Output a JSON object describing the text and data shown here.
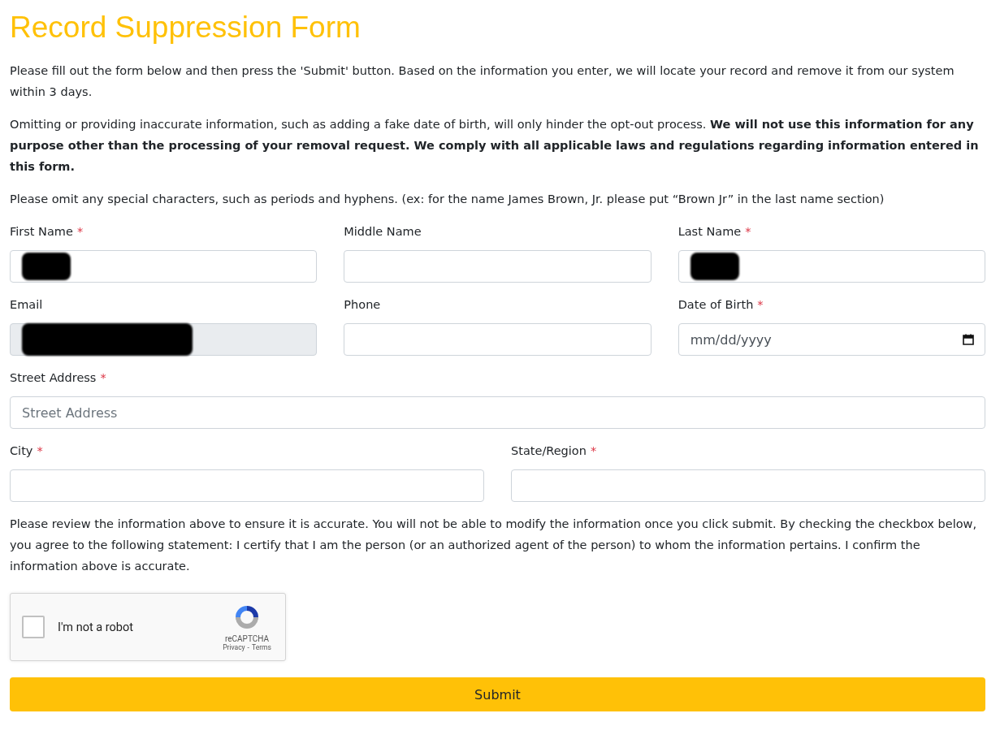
{
  "title": "Record Suppression Form",
  "intro": [
    "Please fill out the form below and then press the 'Submit' button. Based on the information you enter, we will locate your record and remove it from our system within 3 days.",
    "Omitting or providing inaccurate information, such as adding a fake date of birth, will only hinder the opt-out process. **We will not use this information for any purpose other than the processing of your removal request. We comply with all applicable laws and regulations regarding information entered in this form.**",
    "Please omit any special characters, such as periods and hyphens. (ex: for the name James Brown, Jr. please put “Brown Jr” in the last name section)"
  ],
  "rows": [
    {
      "fields": [
        {
          "label": "First Name",
          "required": true,
          "kind": "text",
          "redacted": true,
          "disabled": false
        },
        {
          "label": "Middle Name",
          "required": false,
          "kind": "text",
          "redacted": false,
          "disabled": false
        },
        {
          "label": "Last Name",
          "required": true,
          "kind": "text",
          "redacted": true,
          "disabled": false
        }
      ]
    },
    {
      "fields": [
        {
          "label": "Email",
          "required": false,
          "kind": "text",
          "redacted": true,
          "disabled": true
        },
        {
          "label": "Phone",
          "required": false,
          "kind": "text",
          "redacted": false,
          "disabled": false
        },
        {
          "label": "Date of Birth",
          "required": true,
          "kind": "date",
          "placeholder": "mm/dd/yyyy",
          "redacted": false,
          "disabled": false
        }
      ]
    },
    {
      "fields": [
        {
          "label": "Street Address",
          "required": true,
          "kind": "text",
          "placeholder": "Street Address",
          "redacted": false,
          "disabled": false
        }
      ]
    },
    {
      "fields": [
        {
          "label": "City",
          "required": true,
          "kind": "text",
          "redacted": false,
          "disabled": false
        },
        {
          "label": "State/Region",
          "required": true,
          "kind": "text",
          "redacted": false,
          "disabled": false
        }
      ]
    }
  ],
  "required_mark": "*",
  "statement": "Please review the information above to ensure it is accurate. You will not be able to modify the information once you click submit. By checking the checkbox below, you agree to the following statement: I certify that I am the person (or an authorized agent of the person) to whom the information pertains. I confirm the information above is accurate.",
  "captcha": {
    "label": "I'm not a robot",
    "checked": false,
    "brand": "reCAPTCHA",
    "privacy": "Privacy",
    "separator": "-",
    "terms": "Terms"
  },
  "submit": "Submit"
}
